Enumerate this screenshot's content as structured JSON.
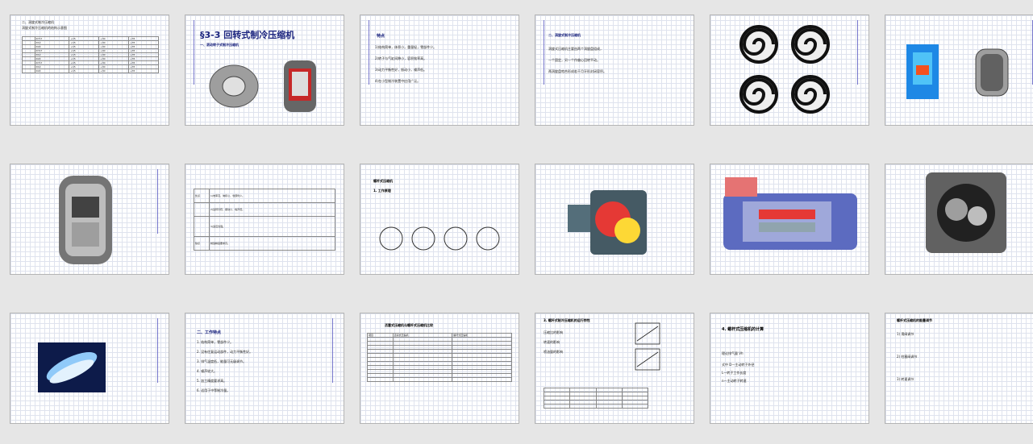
{
  "slides": [
    {
      "id": 1,
      "lines": [
        "二、涡旋式制冷压缩机",
        "涡旋式制冷压缩机的结构示意图"
      ],
      "cells": [
        "R717",
        "R12",
        "R22",
        "+15",
        "+30",
        "+35"
      ]
    },
    {
      "id": 2,
      "title": "§3-3 回转式制冷压缩机",
      "subtitle": "一、滚动转子式制冷压缩机"
    },
    {
      "id": 3,
      "heading": "特点",
      "lines": [
        "1)结构简单，体积小，重量轻，零部件少。",
        "2)转子与气缸间隙小，容积效率高。",
        "3)动力平衡性好，振动小，噪声低。",
        "4)在小型制冷装置中应用广泛。"
      ]
    },
    {
      "id": 4,
      "heading": "二、涡旋式制冷压缩机",
      "lines": [
        "涡旋式压缩机主要由两个涡旋盘组成，",
        "一个固定，另一个作偏心回转平动。",
        "两涡旋盘啮合形成若干月牙形封闭容积。"
      ]
    },
    {
      "id": 5
    },
    {
      "id": 6
    },
    {
      "id": 7
    },
    {
      "id": 8,
      "rows": [
        {
          "h": "优点",
          "t": "1)效率高，体积小，零部件少。"
        },
        {
          "h": "",
          "t": "2)运转平稳，振动小，噪声低。"
        },
        {
          "h": "",
          "t": "3)适应性强。"
        },
        {
          "h": "缺点",
          "t": "制造精度要求高。"
        }
      ]
    },
    {
      "id": 9,
      "heading": "螺杆式压缩机",
      "sub": "1. 工作原理"
    },
    {
      "id": 10
    },
    {
      "id": 11
    },
    {
      "id": 12
    },
    {
      "id": 13
    },
    {
      "id": 14,
      "heading": "二、工作特点",
      "lines": [
        "1. 结构简单，零部件少。",
        "2. 没有往复运动部件，动力平衡性好。",
        "3. 排气温度低，能量可无级调节。",
        "4. 噪声较大。",
        "5. 加工精度要求高。",
        "6. 适用于中等制冷量。"
      ]
    },
    {
      "id": 15,
      "title": "活塞式压缩机与螺杆式压缩机比较",
      "header": [
        "项目",
        "活塞式压缩机",
        "螺杆式压缩机"
      ]
    },
    {
      "id": 16,
      "heading": "3. 螺杆式制冷压缩机的运行特性",
      "lines": [
        "压缩比的影响",
        "转速的影响",
        "喷油量的影响"
      ]
    },
    {
      "id": 17,
      "heading": "4. 螺杆式压缩机的计算",
      "lines": [
        "理论排气量 Vh",
        "式中 D—主动转子外径",
        "L—转子工作长度",
        "n—主动转子转速"
      ]
    },
    {
      "id": 18,
      "heading": "螺杆式压缩机的能量调节",
      "lines": [
        "1) 滑阀调节",
        "2) 柱塞阀调节",
        "3) 转速调节"
      ]
    }
  ]
}
